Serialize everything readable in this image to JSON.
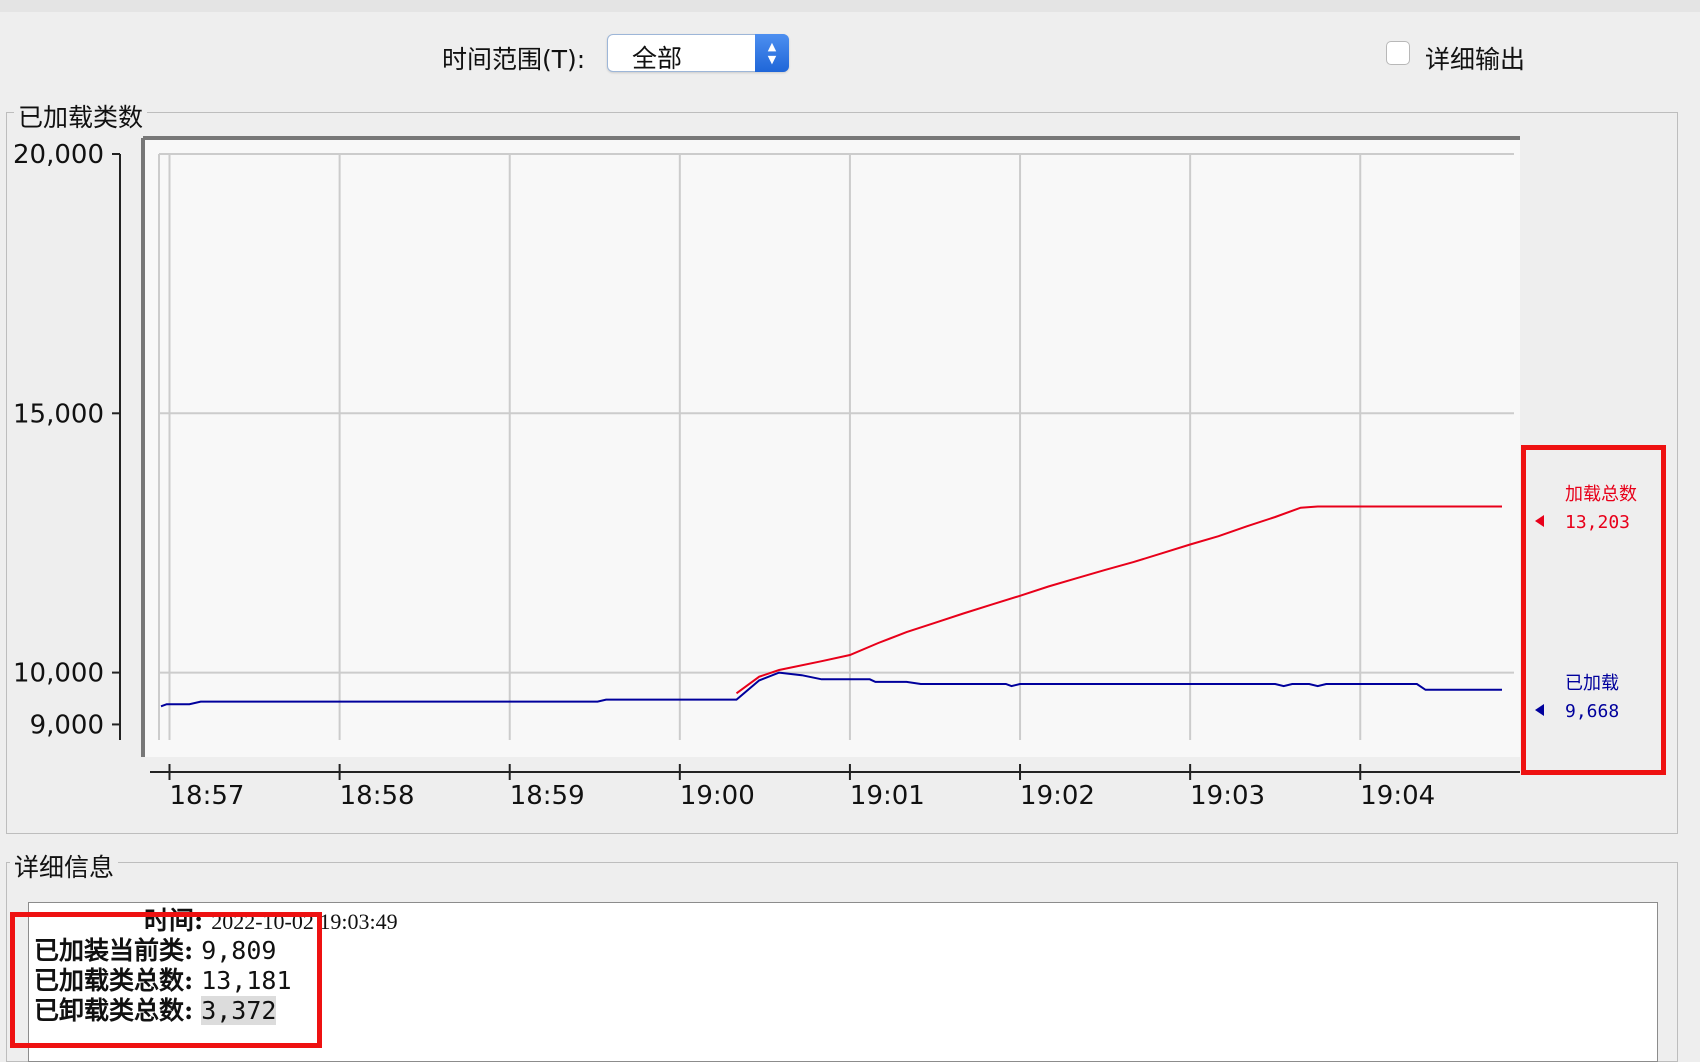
{
  "toolbar": {
    "time_range_label": "时间范围(T):",
    "time_range_value": "全部",
    "verbose_label": "详细输出",
    "verbose_checked": false
  },
  "chart_panel": {
    "title": "已加载类数"
  },
  "chart_data": {
    "type": "line",
    "title": "已加载类数",
    "xlabel": "",
    "ylabel": "",
    "x_ticks": [
      "18:57",
      "18:58",
      "18:59",
      "19:00",
      "19:01",
      "19:02",
      "19:03",
      "19:04"
    ],
    "y_ticks": [
      20000,
      15000,
      10000,
      9000
    ],
    "y_tick_labels": [
      "20,000",
      "15,000",
      "10,000",
      "9,000"
    ],
    "xlim": [
      "18:56:57",
      "19:04:50"
    ],
    "ylim": [
      8700,
      20000
    ],
    "grid": true,
    "legend": "right",
    "series": [
      {
        "name": "加载总数",
        "value_label": "13,203",
        "color": "#e8001a",
        "points": [
          [
            "19:00:20",
            9600
          ],
          [
            "19:00:28",
            9920
          ],
          [
            "19:00:35",
            10050
          ],
          [
            "19:00:50",
            10220
          ],
          [
            "19:01:00",
            10340
          ],
          [
            "19:01:10",
            10570
          ],
          [
            "19:01:20",
            10780
          ],
          [
            "19:01:30",
            10960
          ],
          [
            "19:01:40",
            11140
          ],
          [
            "19:01:50",
            11310
          ],
          [
            "19:02:00",
            11480
          ],
          [
            "19:02:10",
            11660
          ],
          [
            "19:02:20",
            11820
          ],
          [
            "19:02:30",
            11980
          ],
          [
            "19:02:40",
            12130
          ],
          [
            "19:02:50",
            12300
          ],
          [
            "19:03:00",
            12470
          ],
          [
            "19:03:10",
            12630
          ],
          [
            "19:03:20",
            12820
          ],
          [
            "19:03:30",
            13000
          ],
          [
            "19:03:39",
            13180
          ],
          [
            "19:03:45",
            13203
          ],
          [
            "19:04:50",
            13203
          ]
        ]
      },
      {
        "name": "已加载",
        "value_label": "9,668",
        "color": "#00009c",
        "points": [
          [
            "18:56:57",
            9350
          ],
          [
            "18:56:59",
            9390
          ],
          [
            "18:57:07",
            9390
          ],
          [
            "18:57:11",
            9440
          ],
          [
            "18:59:31",
            9440
          ],
          [
            "18:59:34",
            9480
          ],
          [
            "19:00:20",
            9480
          ],
          [
            "19:00:28",
            9850
          ],
          [
            "19:00:35",
            10000
          ],
          [
            "19:00:43",
            9950
          ],
          [
            "19:00:50",
            9870
          ],
          [
            "19:00:55",
            9870
          ],
          [
            "19:01:07",
            9870
          ],
          [
            "19:01:09",
            9820
          ],
          [
            "19:01:20",
            9820
          ],
          [
            "19:01:25",
            9780
          ],
          [
            "19:01:55",
            9780
          ],
          [
            "19:01:57",
            9740
          ],
          [
            "19:02:00",
            9780
          ],
          [
            "19:03:30",
            9780
          ],
          [
            "19:03:33",
            9740
          ],
          [
            "19:03:36",
            9780
          ],
          [
            "19:03:42",
            9780
          ],
          [
            "19:03:45",
            9740
          ],
          [
            "19:03:48",
            9780
          ],
          [
            "19:04:20",
            9780
          ],
          [
            "19:04:23",
            9668
          ],
          [
            "19:04:50",
            9668
          ]
        ]
      }
    ]
  },
  "detail_panel": {
    "title": "详细信息",
    "time_label": "时间:",
    "time_value": "2022-10-02 19:03:49",
    "rows": [
      {
        "label": "已加装当前类:",
        "value": "9,809"
      },
      {
        "label": "已加载类总数:",
        "value": "13,181"
      },
      {
        "label": "已卸载类总数:",
        "value": "3,372"
      }
    ]
  },
  "colors": {
    "highlight_box": "#ee1111",
    "grid": "#cccccc",
    "plot_bg": "#f8f8f8"
  }
}
